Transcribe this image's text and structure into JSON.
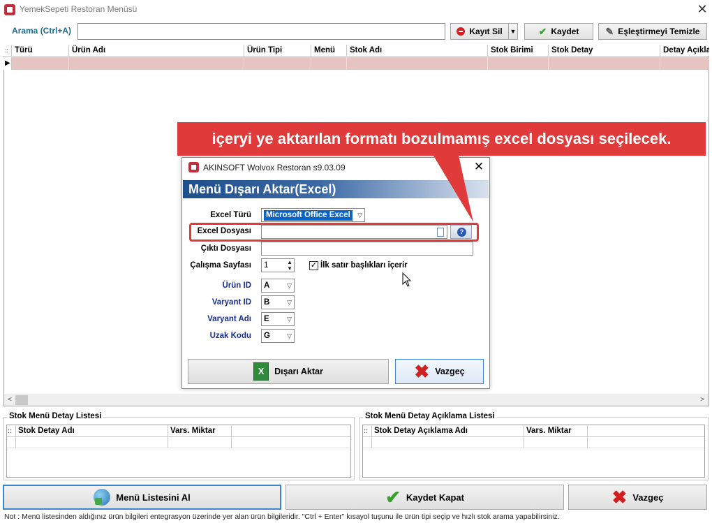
{
  "window": {
    "title": "YemekSepeti Restoran Menüsü",
    "close": "✕"
  },
  "search": {
    "label": "Arama (Ctrl+A)",
    "value": ""
  },
  "toolbar": {
    "kayit_sil": "Kayıt Sil",
    "dropdown": "▼",
    "kaydet": "Kaydet",
    "eslestir": "Eşleştirmeyi Temizle"
  },
  "main_grid": {
    "handle": "::",
    "row_indicator": "▶",
    "columns": [
      "Türü",
      "Ürün Adı",
      "Ürün Tipi",
      "Menü",
      "Stok Adı",
      "Stok Birimi",
      "Stok Detay",
      "Detay Açıkla"
    ]
  },
  "scroll": {
    "left": "<",
    "right": ">"
  },
  "detail_list": {
    "title": "Stok Menü Detay Listesi",
    "handle": "::",
    "columns": [
      "Stok Detay Adı",
      "Vars. Miktar"
    ]
  },
  "desc_list": {
    "title": "Stok Menü Detay Açıklama Listesi",
    "handle": "::",
    "columns": [
      "Stok Detay Açıklama Adı",
      "Vars. Miktar"
    ]
  },
  "bottom": {
    "menu_btn": "Menü Listesini Al",
    "save_close": "Kaydet Kapat",
    "cancel": "Vazgeç"
  },
  "note": "Not :  Menü listesinden aldığınız ürün bilgileri entegrasyon üzerinde yer alan ürün bilgileridir. \"Ctrl + Enter\" kısayol tuşunu ile ürün tipi seçip ve hızlı stok arama yapabilirsiniz.",
  "callout": "içeryi ye aktarılan formatı bozulmamış excel dosyası seçilecek.",
  "dialog": {
    "title": "AKINSOFT Wolvox Restoran s9.03.09",
    "close": "✕",
    "banner": "Menü Dışarı Aktar(Excel)",
    "excel_turu": {
      "label": "Excel Türü",
      "value": "Microsoft Office Excel"
    },
    "excel_dosyasi": {
      "label": "Excel Dosyası",
      "value": ""
    },
    "cikti_dosyasi": {
      "label": "Çıktı Dosyası",
      "value": ""
    },
    "calisma_sayfasi": {
      "label": "Çalışma Sayfası",
      "value": "1"
    },
    "ilk_satir": {
      "label": "İlk satır başlıkları içerir",
      "checked": true,
      "mark": "✓"
    },
    "urun_id": {
      "label": "Ürün ID",
      "value": "A"
    },
    "varyant_id": {
      "label": "Varyant ID",
      "value": "B"
    },
    "varyant_adi": {
      "label": "Varyant Adı",
      "value": "E"
    },
    "uzak_kodu": {
      "label": "Uzak Kodu",
      "value": "G"
    },
    "help_glyph": "?",
    "excel_glyph": "X",
    "export_btn": "Dışarı Aktar",
    "cancel_btn": "Vazgeç"
  },
  "colors": {
    "accent_red": "#e03a3a",
    "banner_blue": "#1d4f8c",
    "row_highlight": "#e5c4c2"
  }
}
